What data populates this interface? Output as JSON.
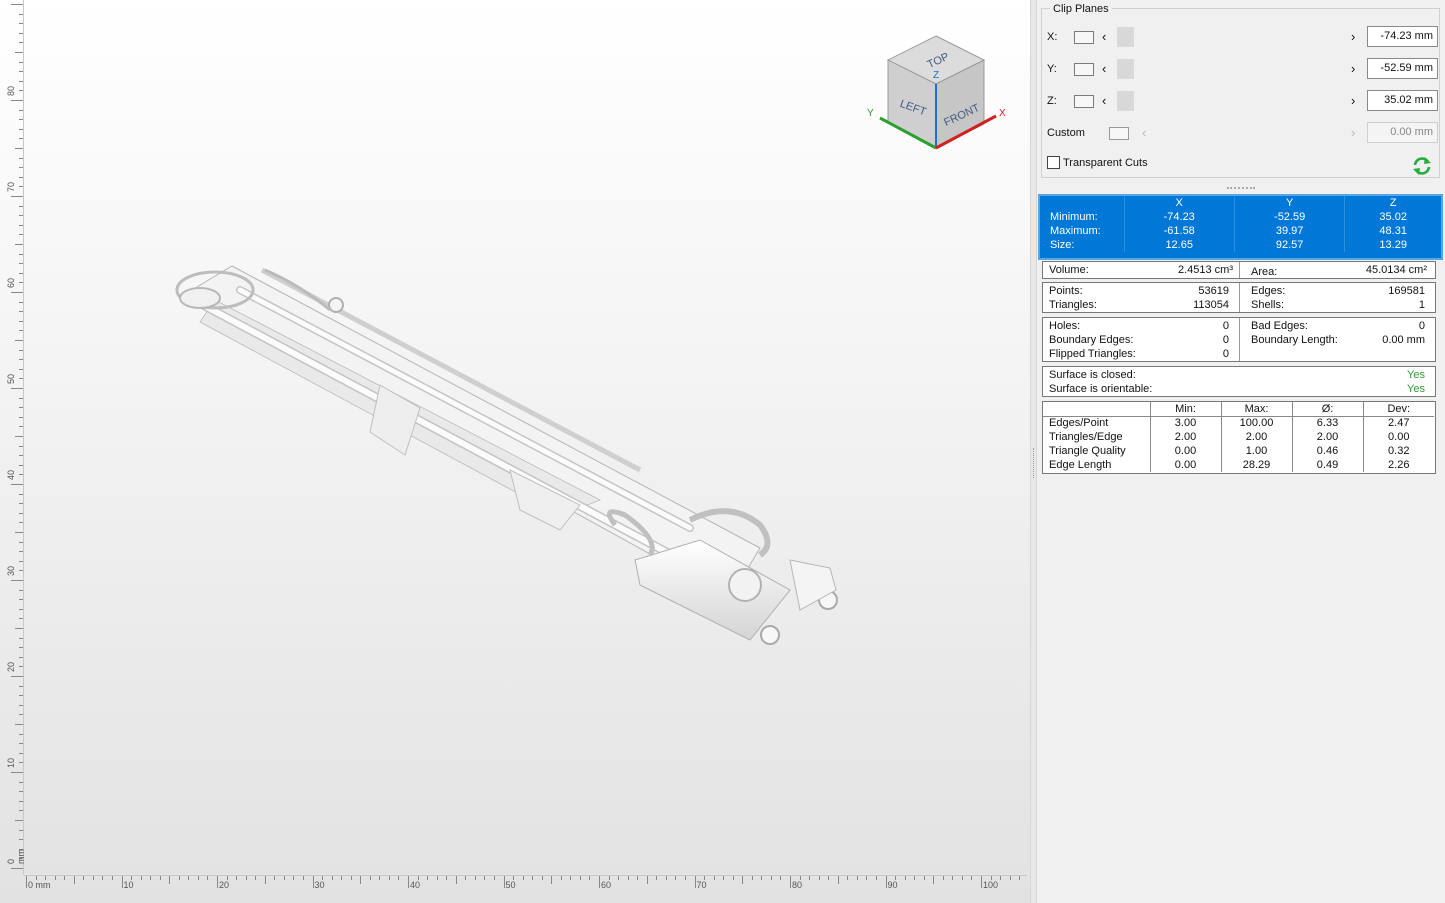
{
  "viewport": {
    "ruler_vertical": [
      "0 mm",
      "10",
      "20",
      "30",
      "40",
      "50",
      "60",
      "70",
      "80"
    ],
    "ruler_horizontal": [
      "0 mm",
      "10",
      "20",
      "30",
      "40",
      "50",
      "60",
      "70",
      "80",
      "90",
      "100"
    ]
  },
  "navcube": {
    "top": "TOP",
    "left": "LEFT",
    "front": "FRONT",
    "axis_x": "X",
    "axis_y": "Y",
    "axis_z": "Z"
  },
  "clip_planes": {
    "title": "Clip Planes",
    "rows": [
      {
        "label": "X:",
        "value": "-74.23 mm"
      },
      {
        "label": "Y:",
        "value": "-52.59 mm"
      },
      {
        "label": "Z:",
        "value": "35.02 mm"
      },
      {
        "label": "Custom",
        "value": "0.00 mm"
      }
    ],
    "transparent_cuts": "Transparent Cuts"
  },
  "bounding_box": {
    "columns": [
      "X",
      "Y",
      "Z"
    ],
    "rows": [
      {
        "label": "Minimum:",
        "values": [
          "-74.23",
          "-52.59",
          "35.02"
        ]
      },
      {
        "label": "Maximum:",
        "values": [
          "-61.58",
          "39.97",
          "48.31"
        ]
      },
      {
        "label": "Size:",
        "values": [
          "12.65",
          "92.57",
          "13.29"
        ]
      }
    ]
  },
  "volume": {
    "label": "Volume:",
    "value": "2.4513 cm³"
  },
  "area": {
    "label": "Area:",
    "value": "45.0134 cm²"
  },
  "counts": {
    "points_label": "Points:",
    "points": "53619",
    "triangles_label": "Triangles:",
    "triangles": "113054",
    "edges_label": "Edges:",
    "edges": "169581",
    "shells_label": "Shells:",
    "shells": "1"
  },
  "defects": {
    "holes_label": "Holes:",
    "holes": "0",
    "boundary_edges_label": "Boundary Edges:",
    "boundary_edges": "0",
    "flipped_label": "Flipped Triangles:",
    "flipped": "0",
    "bad_edges_label": "Bad Edges:",
    "bad_edges": "0",
    "boundary_length_label": "Boundary Length:",
    "boundary_length": "0.00 mm"
  },
  "surface": {
    "closed_label": "Surface is closed:",
    "closed": "Yes",
    "orientable_label": "Surface is orientable:",
    "orientable": "Yes"
  },
  "stats": {
    "columns": [
      "Min:",
      "Max:",
      "Ø:",
      "Dev:"
    ],
    "rows": [
      {
        "label": "Edges/Point",
        "values": [
          "3.00",
          "100.00",
          "6.33",
          "2.47"
        ]
      },
      {
        "label": "Triangles/Edge",
        "values": [
          "2.00",
          "2.00",
          "2.00",
          "0.00"
        ]
      },
      {
        "label": "Triangle Quality",
        "values": [
          "0.00",
          "1.00",
          "0.46",
          "0.32"
        ]
      },
      {
        "label": "Edge Length",
        "values": [
          "0.00",
          "28.29",
          "0.49",
          "2.26"
        ]
      }
    ]
  },
  "colors": {
    "selection": "#0078d7",
    "ok": "#2f9a2f",
    "refresh": "#27ae3f"
  }
}
